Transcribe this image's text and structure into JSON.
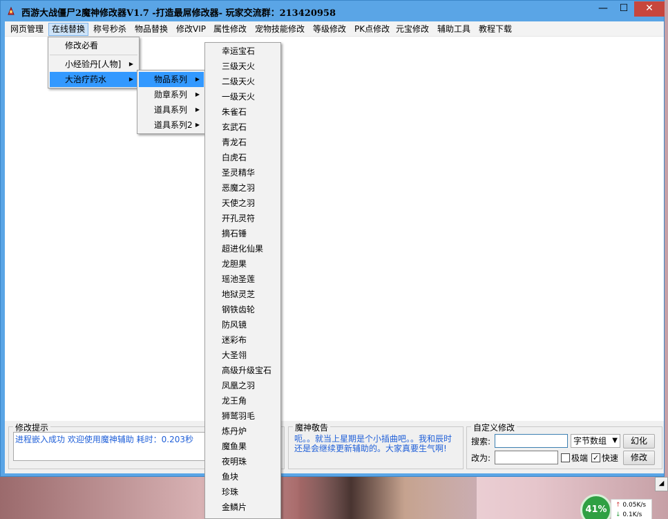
{
  "window": {
    "title": "西游大战僵尸2魔神修改器V1.7 -打造最屌修改器-  玩家交流群：213420958",
    "minimize_glyph": "—",
    "maximize_glyph": "☐",
    "close_glyph": "✕"
  },
  "menubar": {
    "items": [
      {
        "label": "网页管理"
      },
      {
        "label": "在线替换"
      },
      {
        "label": "称号秒杀"
      },
      {
        "label": "物品替换"
      },
      {
        "label": "修改VIP"
      },
      {
        "label": "属性修改"
      },
      {
        "label": "宠物技能修改"
      },
      {
        "label": "等级修改"
      },
      {
        "label": "PK点修改"
      },
      {
        "label": "元宝修改"
      },
      {
        "label": "辅助工具"
      },
      {
        "label": "教程下载"
      }
    ]
  },
  "menu_level1": {
    "items": [
      {
        "label": "修改必看"
      },
      {
        "label": "小经验丹[人物]"
      },
      {
        "label": "大治疗药水"
      }
    ]
  },
  "menu_level2": {
    "items": [
      {
        "label": "物品系列"
      },
      {
        "label": "勋章系列"
      },
      {
        "label": "道具系列"
      },
      {
        "label": "道具系列2"
      }
    ]
  },
  "menu_level3": {
    "items": [
      "幸运宝石",
      "三级天火",
      "二级天火",
      "一级天火",
      "朱雀石",
      "玄武石",
      "青龙石",
      "白虎石",
      "圣灵精华",
      "恶魔之羽",
      "天使之羽",
      "开孔灵符",
      "摘石锤",
      "超进化仙果",
      "龙胆果",
      "瑶池圣莲",
      "地狱灵芝",
      "钢铁齿轮",
      "防风镜",
      "迷彩布",
      "大圣翎",
      "高级升级宝石",
      "凤凰之羽",
      "龙王角",
      "狮鹫羽毛",
      "炼丹炉",
      "魔鱼果",
      "夜明珠",
      "鱼块",
      "珍珠",
      "金鳞片"
    ]
  },
  "status_group": {
    "title": "修改提示",
    "message": "进程嵌入成功 欢迎使用魔神辅助 耗时：0.203秒"
  },
  "notice_group": {
    "title": "魔神敬告",
    "line1": "呃。。就当上星期是个小插曲吧。。我和辰时",
    "line2": "还是会继续更新辅助的。大家真要生气啊!"
  },
  "custom_group": {
    "title": "自定义修改",
    "search_label": "搜索:",
    "change_label": "改为:",
    "type_select": "字节数组",
    "transform_button": "幻化",
    "modify_button": "修改",
    "extreme_label": "极端",
    "fast_label": "快速",
    "extreme_checked": false,
    "fast_checked": true
  },
  "network": {
    "percent": "41%",
    "up": "0.05K/s",
    "down": "0.1K/s"
  },
  "colors": {
    "titlebar": "#5aa5e6",
    "highlight": "#3399ff",
    "status_text": "#1f5fd8",
    "close_button": "#c7463d"
  }
}
